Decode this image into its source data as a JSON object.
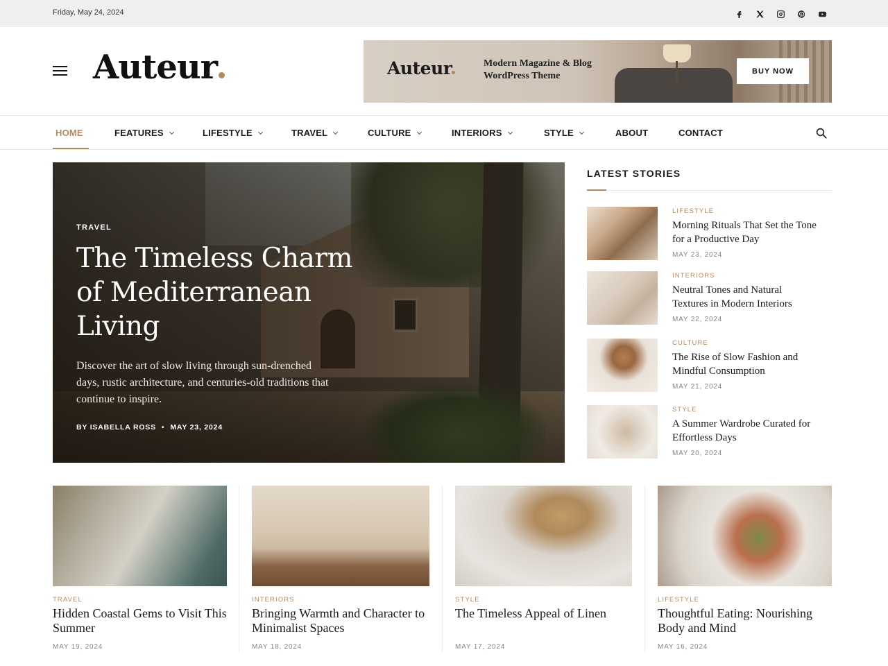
{
  "topbar": {
    "date": "Friday, May 24, 2024",
    "social": [
      "facebook-icon",
      "x-icon",
      "instagram-icon",
      "pinterest-icon",
      "youtube-icon"
    ]
  },
  "header": {
    "logo": "Auteur",
    "banner": {
      "logo": "Auteur",
      "line1": "Modern Magazine & Blog",
      "line2": "WordPress Theme",
      "button": "BUY NOW"
    }
  },
  "nav": {
    "items": [
      {
        "label": "HOME",
        "active": true,
        "dropdown": false
      },
      {
        "label": "FEATURES",
        "dropdown": true
      },
      {
        "label": "LIFESTYLE",
        "dropdown": true
      },
      {
        "label": "TRAVEL",
        "dropdown": true
      },
      {
        "label": "CULTURE",
        "dropdown": true
      },
      {
        "label": "INTERIORS",
        "dropdown": true
      },
      {
        "label": "STYLE",
        "dropdown": true
      },
      {
        "label": "ABOUT",
        "dropdown": false
      },
      {
        "label": "CONTACT",
        "dropdown": false
      }
    ]
  },
  "hero": {
    "category": "TRAVEL",
    "title": "The Timeless Charm of Mediterranean Living",
    "description": "Discover the art of slow living through sun-drenched days, rustic architecture, and centuries-old traditions that continue to inspire.",
    "author": "BY ISABELLA ROSS",
    "separator": "•",
    "date": "MAY 23, 2024"
  },
  "latest": {
    "heading": "LATEST STORIES",
    "stories": [
      {
        "category": "LIFESTYLE",
        "title": "Morning Rituals That Set the Tone for a Productive Day",
        "date": "MAY 23, 2024"
      },
      {
        "category": "INTERIORS",
        "title": "Neutral Tones and Natural Textures in Modern Interiors",
        "date": "MAY 22, 2024"
      },
      {
        "category": "CULTURE",
        "title": "The Rise of Slow Fashion and Mindful Consumption",
        "date": "MAY 21, 2024"
      },
      {
        "category": "STYLE",
        "title": "A Summer Wardrobe Curated for Effortless Days",
        "date": "MAY 20, 2024"
      }
    ]
  },
  "cards": [
    {
      "category": "TRAVEL",
      "title": "Hidden Coastal Gems to Visit This Summer",
      "date": "MAY 19, 2024"
    },
    {
      "category": "INTERIORS",
      "title": "Bringing Warmth and Character to Minimalist Spaces",
      "date": "MAY 18, 2024"
    },
    {
      "category": "STYLE",
      "title": "The Timeless Appeal of Linen",
      "date": "MAY 17, 2024"
    },
    {
      "category": "LIFESTYLE",
      "title": "Thoughtful Eating: Nourishing Body and Mind",
      "date": "MAY 16, 2024"
    }
  ],
  "colors": {
    "accent": "#b5895e",
    "text": "#1a1a1a",
    "muted": "#888888",
    "topbar_bg": "#efefef"
  }
}
